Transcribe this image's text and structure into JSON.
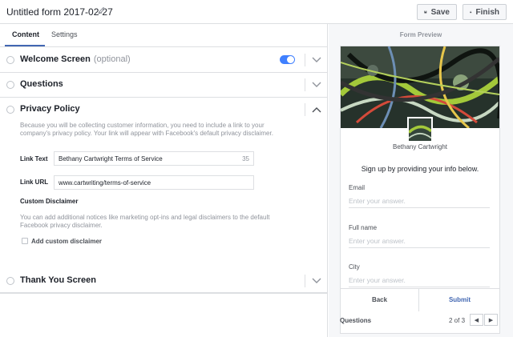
{
  "header": {
    "form_title": "Untitled form 2017-02-27",
    "save_label": "Save",
    "finish_label": "Finish"
  },
  "tabs": [
    {
      "label": "Content",
      "active": true
    },
    {
      "label": "Settings",
      "active": false
    }
  ],
  "sections": {
    "welcome": {
      "title": "Welcome Screen",
      "optional": "(optional)",
      "toggle_on": true
    },
    "questions": {
      "title": "Questions"
    },
    "privacy": {
      "title": "Privacy Policy",
      "description": "Because you will be collecting customer information, you need to include a link to your company's privacy policy. Your link will appear with Facebook's default privacy disclaimer.",
      "link_text_label": "Link Text",
      "link_text_value": "Bethany Cartwright Terms of Service",
      "link_text_count": "35",
      "link_url_label": "Link URL",
      "link_url_value": "www.cartwriting/terms-of-service",
      "custom_title": "Custom Disclaimer",
      "custom_desc": "You can add additional notices like marketing opt-ins and legal disclaimers to the default Facebook privacy disclaimer.",
      "checkbox_label": "Add custom disclaimer"
    },
    "thankyou": {
      "title": "Thank You Screen"
    }
  },
  "preview": {
    "title": "Form Preview",
    "page_name": "Bethany Cartwright",
    "headline": "Sign up by providing your info below.",
    "questions": [
      {
        "label": "Email",
        "placeholder": "Enter your answer."
      },
      {
        "label": "Full name",
        "placeholder": "Enter your answer."
      },
      {
        "label": "City",
        "placeholder": "Enter your answer."
      }
    ],
    "back_label": "Back",
    "submit_label": "Submit",
    "nav_label": "Questions",
    "nav_count": "2 of 3"
  },
  "colors": {
    "accent": "#4267b2",
    "toggle": "#4080ff",
    "border": "#dddfe2",
    "muted": "#90949c"
  },
  "icons": [
    "pencil-icon",
    "save-icon",
    "lock-icon",
    "chevron-down-icon",
    "chevron-up-icon",
    "prev-arrow-icon",
    "next-arrow-icon"
  ]
}
